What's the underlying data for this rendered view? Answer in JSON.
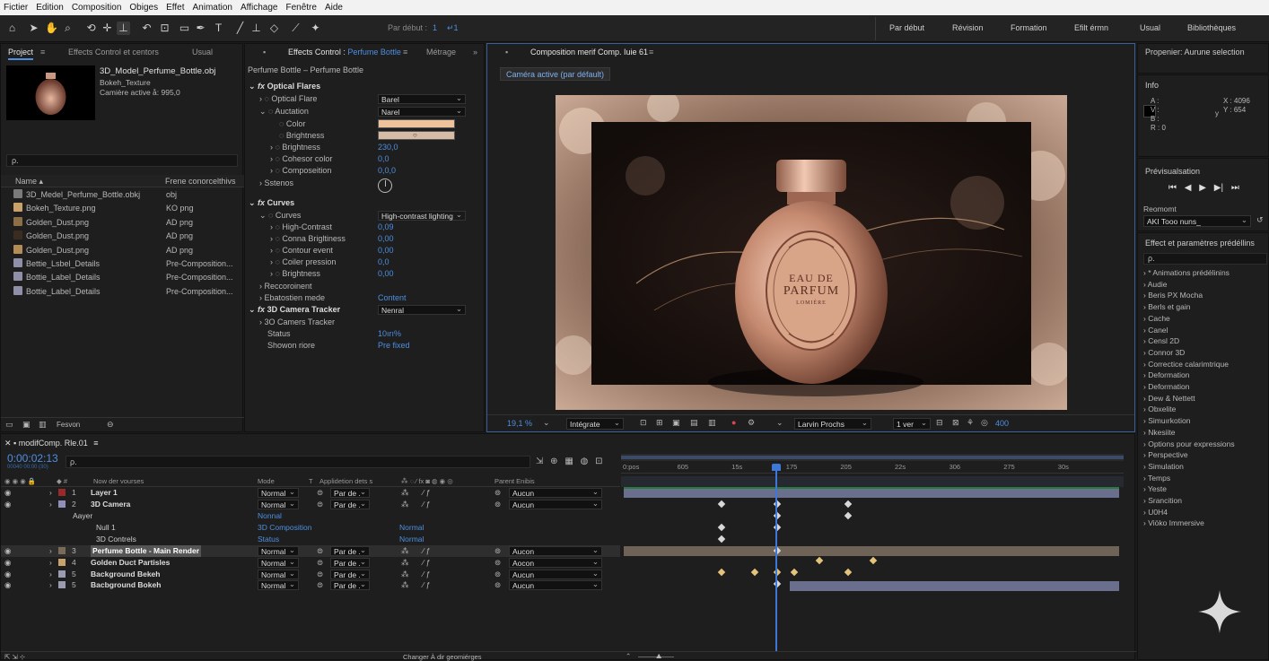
{
  "menu": [
    "Fictier",
    "Edition",
    "Composition",
    "Obiges",
    "Effet",
    "Animation",
    "Affichage",
    "Fenêtre",
    "Aide"
  ],
  "toolbar": {
    "snap_label": "Par début :",
    "snap_v1": "1",
    "snap_v2": "↵1",
    "workspaces": [
      "Par début",
      "Révision",
      "Formation",
      "Efilt érmn",
      "Usual",
      "Bibliothèques"
    ]
  },
  "project": {
    "tabs": [
      "Project",
      "Effects Control et centors",
      "Usual"
    ],
    "file_name": "3D_Model_Perfume_Bottle.obj",
    "file_sub1": "Bokeh_Texture",
    "file_sub2": "Camière active å: 995,0",
    "search_placeholder": "ρ.",
    "col_name": "Name ▴",
    "col_type": "Frene conorcelthivs",
    "files": [
      {
        "name": "3D_Medel_Perfume_Bottle.obkj",
        "type": "obj",
        "color": "#7a7a7a"
      },
      {
        "name": "Bokeh_Texture.png",
        "type": "KO png",
        "color": "#c9a26b"
      },
      {
        "name": "Golden_Dust.png",
        "type": "AD png",
        "color": "#8c6f47"
      },
      {
        "name": "Golden_Dust.png",
        "type": "AD png",
        "color": "#3a2d20"
      },
      {
        "name": "Golden_Dust.png",
        "type": "AD png",
        "color": "#b48c55"
      },
      {
        "name": "Bettie_Lsbel_Details",
        "type": "Pre-Composition...",
        "color": "#8f8fa8"
      },
      {
        "name": "Bottie_Label_Details",
        "type": "Pre-Composition...",
        "color": "#8f8fa8"
      },
      {
        "name": "Bottie_Label_Details",
        "type": "Pre-Composition...",
        "color": "#8f8fa8"
      }
    ],
    "footer_label": "Fesvon"
  },
  "effects": {
    "tab": "Effects Control :",
    "tab_target": "Perfume Bottle",
    "tab2": "Métrage",
    "header": "Perfume Bottle – Perfume Bottle",
    "optical": "Optical Flares",
    "p_flare": "Optical Flare",
    "v_flare": "Barel",
    "p_anim": "Auctation",
    "v_anim": "Narel",
    "p_color": "Color",
    "p_bright": "Brightness",
    "p_bright2": "Brightness",
    "v_bright2": "230,0",
    "p_colcol": "Cohesor color",
    "v_colcol": "0,0",
    "p_comp": "Composeition",
    "v_comp": "0,0,0",
    "p_set": "Sstenos",
    "curves": "Curves",
    "p_curves": "Curves",
    "v_curves": "High-contrast lighting",
    "p_hc": "High-Contrast",
    "v_hc": "0,09",
    "p_cb": "Conna Brigltiness",
    "v_cb": "0,00",
    "p_ce": "Contour event",
    "v_ce": "0,00",
    "p_cp": "Coiler pression",
    "v_cp": "0,0",
    "p_br": "Brightness",
    "v_br": "0,00",
    "p_rec": "Reccoroinent",
    "p_eb": "Ebatostien mede",
    "v_eb": "Content",
    "tracker": "3D Camera Tracker",
    "v_tracker": "Nenral",
    "p_ct": "3O Camers Tracker",
    "p_status": "Status",
    "v_status": "10ırı%",
    "p_shown": "Showon riore",
    "v_shown": "Pre fixed"
  },
  "comp": {
    "tab": "Composition merif Comp. Iuie 61",
    "active_camera": "Caméra active (par défault)",
    "label_l1": "EAU DE",
    "label_l2": "PARFUM",
    "label_l3": "LOMIÈRE",
    "zoom": "19,1 %",
    "res": "Intégrate",
    "view": "Larvin Prochs",
    "views": "1 ver",
    "exposure": "400"
  },
  "right": {
    "prop": "Propenier: Aurune selection",
    "info": "Info",
    "a": "A :",
    "v": "V :",
    "b": "B :",
    "r": "R :  0",
    "x": "X :  4096",
    "y": "Y :  654",
    "y_lbl": "y",
    "preview": "Prévisualsation",
    "reset": "Reomomt",
    "reset_val": "AKI Tooo nuns_",
    "efp": "Effect et paramètres prédéllins",
    "search": "ρ.",
    "cats": [
      "* Animations prédélinins",
      "Audie",
      "Beris PX Mocha",
      "Berls et gain",
      "Cache",
      "Canel",
      "Censl 2D",
      "Connor 3D",
      "Correctice calarimtrique",
      "Deformation",
      "Deformation",
      "Dew & Nettett",
      "Obxelite",
      "Simuırkotion",
      "Nkesiite",
      "Options pour expressions",
      "Perspective",
      "Simulation",
      "Temps",
      "Yeste",
      "Srancition",
      "U0H4",
      "Viöko Immersive"
    ]
  },
  "timeline": {
    "comp_name": "modifComp. Rle.01",
    "timecode": "0:00:02:13",
    "tc_sub": "00040 00:00 (30)",
    "search": "ρ.",
    "h_name": "Now der vourses",
    "h_mode": "Mode",
    "h_t": "T",
    "h_appl": "Applidetion dets s",
    "h_parent": "Parent Enibis",
    "ruler": [
      "0:pos",
      "605",
      "15s",
      "175",
      "205",
      "22s",
      "306",
      "275",
      "30s"
    ],
    "layers": [
      {
        "num": "1",
        "name": "Layer 1",
        "mode": "Normal",
        "app": "Par de .",
        "parent": "Aucun",
        "color": "#9a2a2a"
      },
      {
        "num": "2",
        "name": "3D Camera",
        "mode": "Normal",
        "app": "Par de .",
        "parent": "Aucun",
        "color": "#8f8fb8"
      }
    ],
    "sub_aayer": "Aayer",
    "sub_normal": "Nonnal",
    "null1": "Null 1",
    "null1_v": "3D Composition",
    "null1_m": "Normal",
    "ctrl": "3D Contrels",
    "ctrl_v": "Status",
    "ctrl_m": "Normal",
    "layers2": [
      {
        "num": "3",
        "name": "Perfume Bottle - Main Render",
        "mode": "Normal",
        "app": "Par de .",
        "parent": "Aucon",
        "color": "#7a6a5a"
      },
      {
        "num": "4",
        "name": "Golden Duct Partisles",
        "mode": "Normal",
        "app": "Par de .",
        "parent": "Aocon",
        "color": "#c9a26b"
      },
      {
        "num": "5",
        "name": "Background Bekeh",
        "mode": "Normal",
        "app": "Par de .",
        "parent": "Aucun",
        "color": "#9b9bb0"
      },
      {
        "num": "5",
        "name": "Bacbground Bokeh",
        "mode": "Normal",
        "app": "Par de .",
        "parent": "Aucun",
        "color": "#9b9bb0"
      }
    ],
    "footer": "Changer À dir geomiérges"
  },
  "colors": {
    "accent": "#4d8fe0",
    "swatch_color": "#eec39b",
    "swatch_bright": "#d6bba5"
  }
}
